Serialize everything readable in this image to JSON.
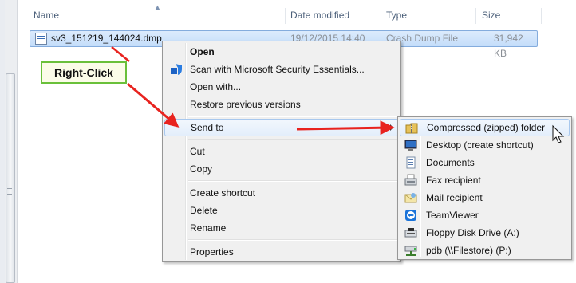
{
  "header": {
    "columns": [
      "Name",
      "Date modified",
      "Type",
      "Size"
    ]
  },
  "file": {
    "name": "sv3_151219_144024.dmp",
    "date": "19/12/2015 14:40",
    "type": "Crash Dump File",
    "size": "31,942 KB"
  },
  "annotation": {
    "label": "Right-Click",
    "color": "#e8231f",
    "border_color": "#6ac03a"
  },
  "context_menu": {
    "items": [
      {
        "label": "Open",
        "icon": ""
      },
      {
        "label": "Scan with Microsoft Security Essentials...",
        "icon": "security-essentials-icon"
      },
      {
        "label": "Open with...",
        "icon": ""
      },
      {
        "label": "Restore previous versions",
        "icon": ""
      },
      {
        "label": "Send to",
        "icon": "",
        "highlighted": true
      },
      {
        "label": "Cut",
        "icon": ""
      },
      {
        "label": "Copy",
        "icon": ""
      },
      {
        "label": "Create shortcut",
        "icon": ""
      },
      {
        "label": "Delete",
        "icon": ""
      },
      {
        "label": "Rename",
        "icon": ""
      },
      {
        "label": "Properties",
        "icon": ""
      }
    ]
  },
  "send_to_menu": {
    "items": [
      {
        "label": "Compressed (zipped) folder",
        "icon": "zip-folder-icon"
      },
      {
        "label": "Desktop (create shortcut)",
        "icon": "desktop-icon"
      },
      {
        "label": "Documents",
        "icon": "documents-icon"
      },
      {
        "label": "Fax recipient",
        "icon": "fax-icon"
      },
      {
        "label": "Mail recipient",
        "icon": "mail-icon"
      },
      {
        "label": "TeamViewer",
        "icon": "teamviewer-icon"
      },
      {
        "label": "Floppy Disk Drive (A:)",
        "icon": "floppy-drive-icon"
      },
      {
        "label": "pdb (\\\\Filestore) (P:)",
        "icon": "network-drive-icon"
      }
    ]
  },
  "colors": {
    "selection": "#cce1fb",
    "menu_bg": "#f0f0f0",
    "hover_border": "#a8c8ee"
  }
}
